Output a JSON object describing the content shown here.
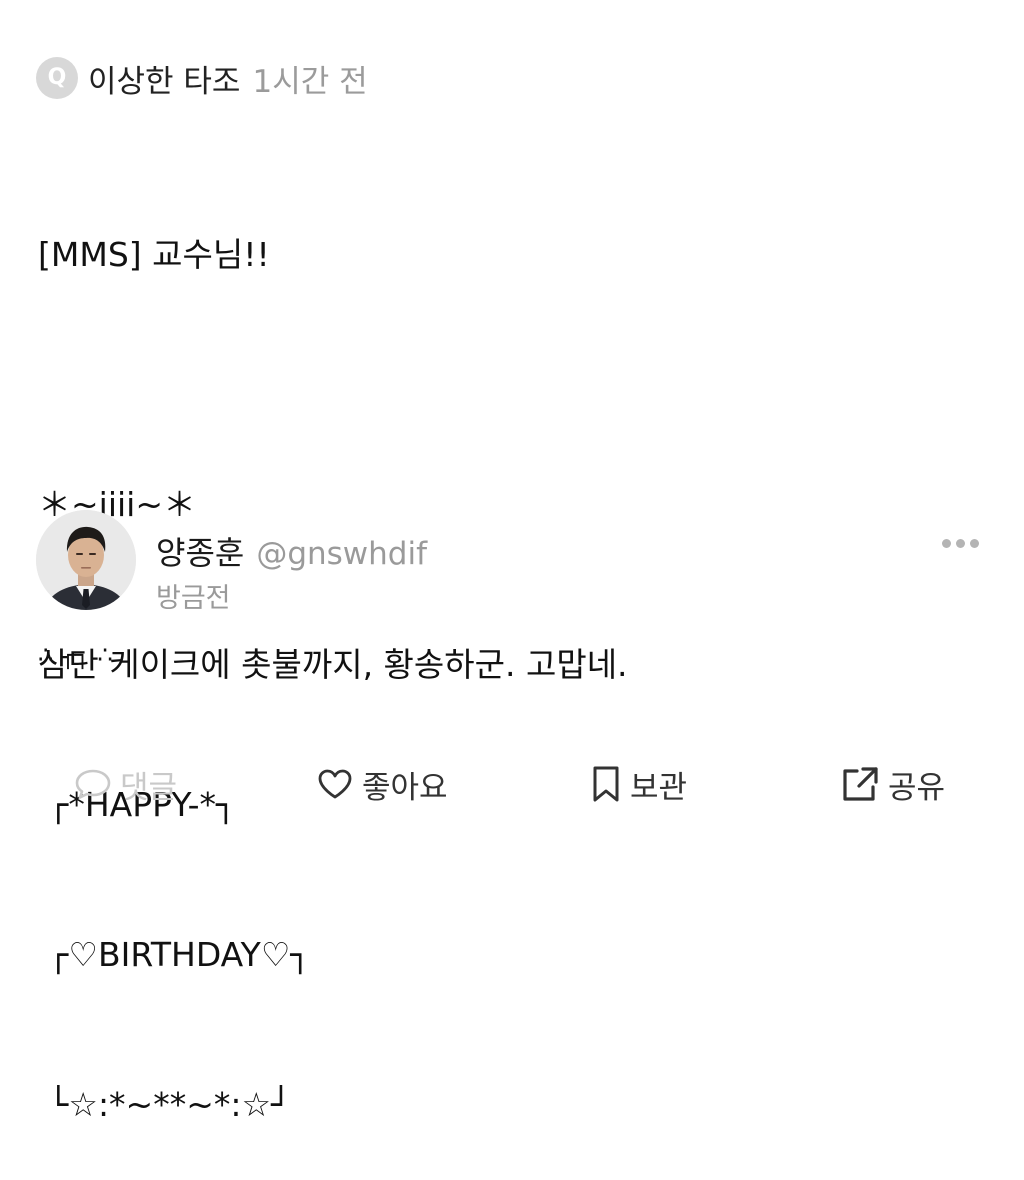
{
  "question": {
    "badge_letter": "Q",
    "asker_name": "이상한 타조",
    "time": "1시간 전",
    "body_lines": [
      "[MMS] 교수님!!",
      "",
      "＊~iiii~＊",
      "∴ ┌┐ ∴",
      " ┌*HAPPY-*┐",
      " ┌♡BIRTHDAY♡┐",
      " └☆:*~**~*:☆┘"
    ]
  },
  "answer": {
    "author_name": "양종훈",
    "author_handle": "@gnswhdif",
    "time": "방금전",
    "text": "삼단 케이크에 촛불까지, 황송하군. 고맙네."
  },
  "actions": {
    "comment": "댓글",
    "like": "좋아요",
    "save": "보관",
    "share": "공유"
  },
  "colors": {
    "text_primary": "#111111",
    "text_secondary": "#9b9b9b",
    "badge_bg": "#d8d8d8",
    "disabled": "#c9c9c9"
  }
}
